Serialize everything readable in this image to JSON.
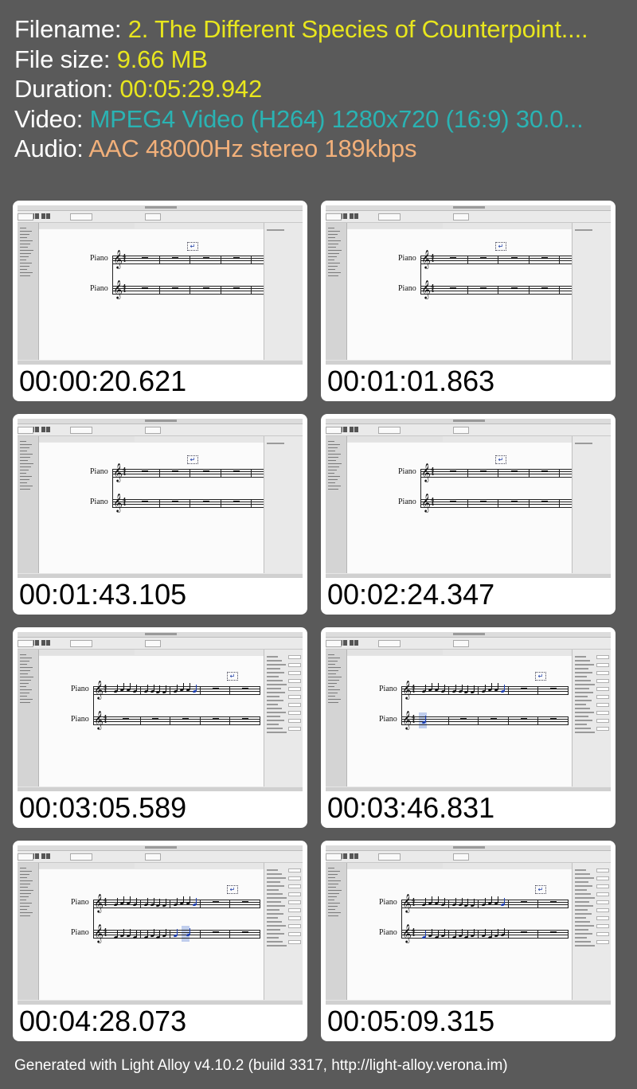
{
  "meta": {
    "filename_label": "Filename: ",
    "filename_value": "2. The Different Species of Counterpoint....",
    "filesize_label": "File size: ",
    "filesize_value": "9.66 MB",
    "duration_label": "Duration: ",
    "duration_value": "00:05:29.942",
    "video_label": "Video: ",
    "video_value": "MPEG4 Video (H264) 1280x720 (16:9) 30.0...",
    "audio_label": "Audio: ",
    "audio_value": "AAC 48000Hz stereo 189kbps"
  },
  "colors": {
    "background": "#5a5a5a",
    "filename": "#e8e61e",
    "video": "#2ab3b3",
    "audio": "#f2b07a",
    "note_selected": "#1e3fb0"
  },
  "score": {
    "staff1_label": "Piano",
    "staff2_label": "Piano",
    "time_sig_top": "4",
    "time_sig_bottom": "4"
  },
  "thumbnails": [
    {
      "timestamp": "00:00:20.621",
      "variant": "empty"
    },
    {
      "timestamp": "00:01:01.863",
      "variant": "empty"
    },
    {
      "timestamp": "00:01:43.105",
      "variant": "empty"
    },
    {
      "timestamp": "00:02:24.347",
      "variant": "empty"
    },
    {
      "timestamp": "00:03:05.589",
      "variant": "top-notes"
    },
    {
      "timestamp": "00:03:46.831",
      "variant": "bottom-selected"
    },
    {
      "timestamp": "00:04:28.073",
      "variant": "both-notes"
    },
    {
      "timestamp": "00:05:09.315",
      "variant": "both-full"
    }
  ],
  "footer": "Generated with Light Alloy v4.10.2 (build 3317, http://light-alloy.verona.im)"
}
